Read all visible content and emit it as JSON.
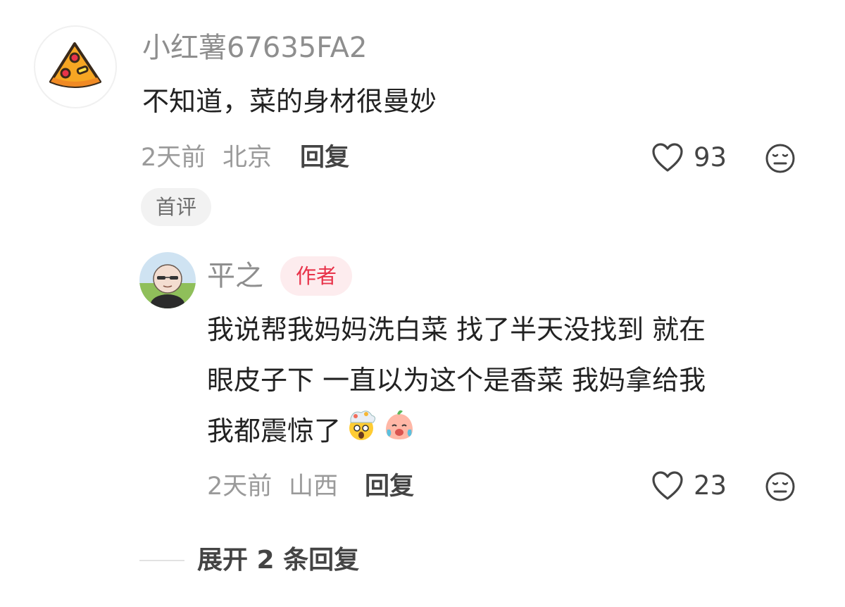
{
  "comment": {
    "username": "小红薯67635FA2",
    "avatar_icon": "pizza-icon",
    "text": "不知道，菜的身材很曼妙",
    "time": "2天前",
    "location": "北京",
    "reply_label": "回复",
    "like_count": "93",
    "badge": "首评"
  },
  "reply": {
    "username": "平之",
    "author_badge": "作者",
    "lines": [
      "我说帮我妈妈洗白菜 找了半天没找到 就在",
      "眼皮子下 一直以为这个是香菜 我妈拿给我",
      "我都震惊了"
    ],
    "emojis": [
      "exploding-head-emoji",
      "crying-face-emoji"
    ],
    "time": "2天前",
    "location": "山西",
    "reply_label": "回复",
    "like_count": "23"
  },
  "expand": {
    "label": "展开 2 条回复"
  },
  "colors": {
    "author_badge_text": "#e8334a",
    "author_badge_bg": "#fdecee"
  }
}
